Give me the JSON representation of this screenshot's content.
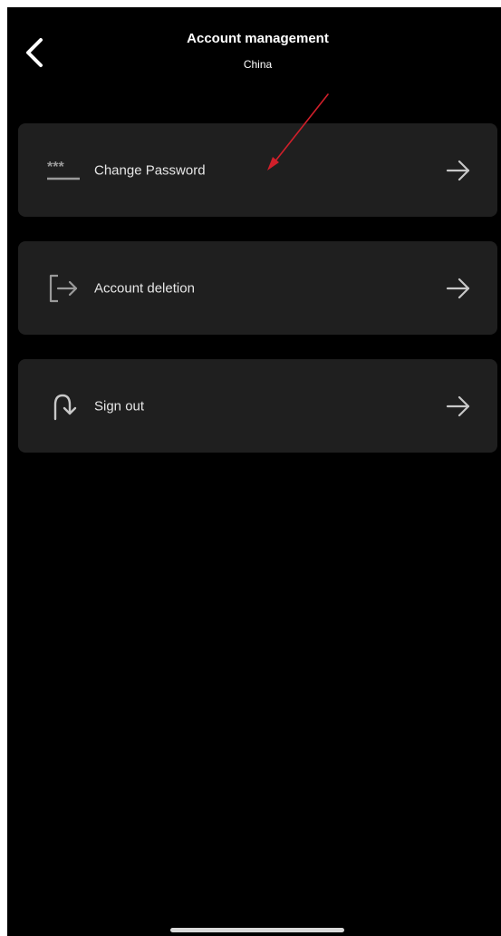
{
  "header": {
    "title": "Account management",
    "subtitle": "China",
    "back_icon": "chevron-left-icon"
  },
  "menu": {
    "items": [
      {
        "label": "Change Password",
        "icon": "password-dots-icon",
        "arrow_icon": "arrow-right-icon"
      },
      {
        "label": "Account deletion",
        "icon": "exit-bracket-icon",
        "arrow_icon": "arrow-right-icon"
      },
      {
        "label": "Sign out",
        "icon": "turn-down-arrow-icon",
        "arrow_icon": "arrow-right-icon"
      }
    ]
  },
  "colors": {
    "background": "#000000",
    "card": "#1f1f1f",
    "text": "#ffffff",
    "annotation": "#d01f2a"
  }
}
